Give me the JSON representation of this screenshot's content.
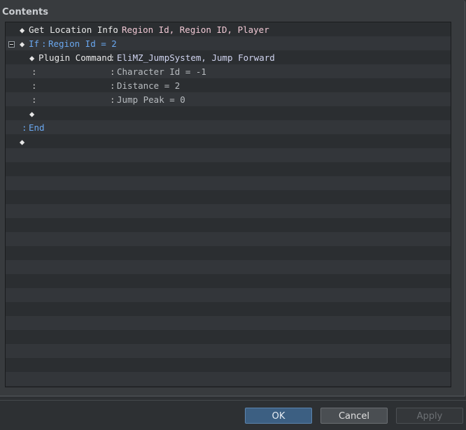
{
  "panel": {
    "title": "Contents"
  },
  "icons": {
    "diamond": "◆",
    "collapse": "minus-box"
  },
  "rows": {
    "r0": {
      "cmd": "Get Location Info",
      "sep": ":",
      "args": "Region Id, Region ID, Player"
    },
    "r1": {
      "cmd": "If",
      "sep": ":",
      "args": "Region Id = 2"
    },
    "r2": {
      "cmd": "Plugin Command",
      "sep": ":",
      "args": "EliMZ_JumpSystem, Jump Forward"
    },
    "r3": {
      "pre": ":",
      "sep": ":",
      "args": "Character Id = -1"
    },
    "r4": {
      "pre": ":",
      "sep": ":",
      "args": "Distance = 2"
    },
    "r5": {
      "pre": ":",
      "sep": ":",
      "args": "Jump Peak = 0"
    },
    "r7": {
      "sep": ":",
      "cmd": "End"
    }
  },
  "buttons": {
    "ok": "OK",
    "cancel": "Cancel",
    "apply": "Apply"
  }
}
